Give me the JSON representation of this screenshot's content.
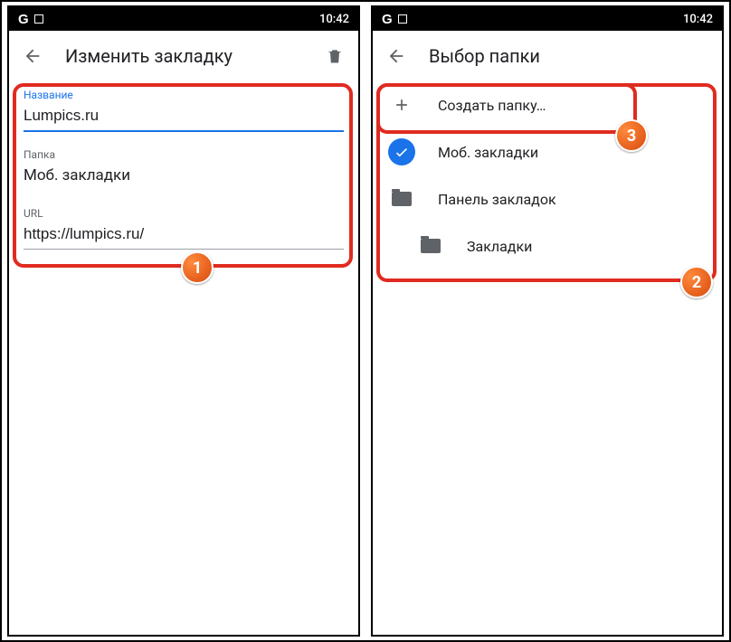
{
  "status": {
    "time": "10:42"
  },
  "left": {
    "title": "Изменить закладку",
    "fields": {
      "name_label": "Название",
      "name_value": "Lumpics.ru",
      "folder_label": "Папка",
      "folder_value": "Моб. закладки",
      "url_label": "URL",
      "url_value": "https://lumpics.ru/"
    }
  },
  "right": {
    "title": "Выбор папки",
    "items": {
      "create": "Создать папку…",
      "mobile": "Моб. закладки",
      "bar": "Панель закладок",
      "bookmarks": "Закладки"
    }
  },
  "badges": {
    "b1": "1",
    "b2": "2",
    "b3": "3"
  }
}
